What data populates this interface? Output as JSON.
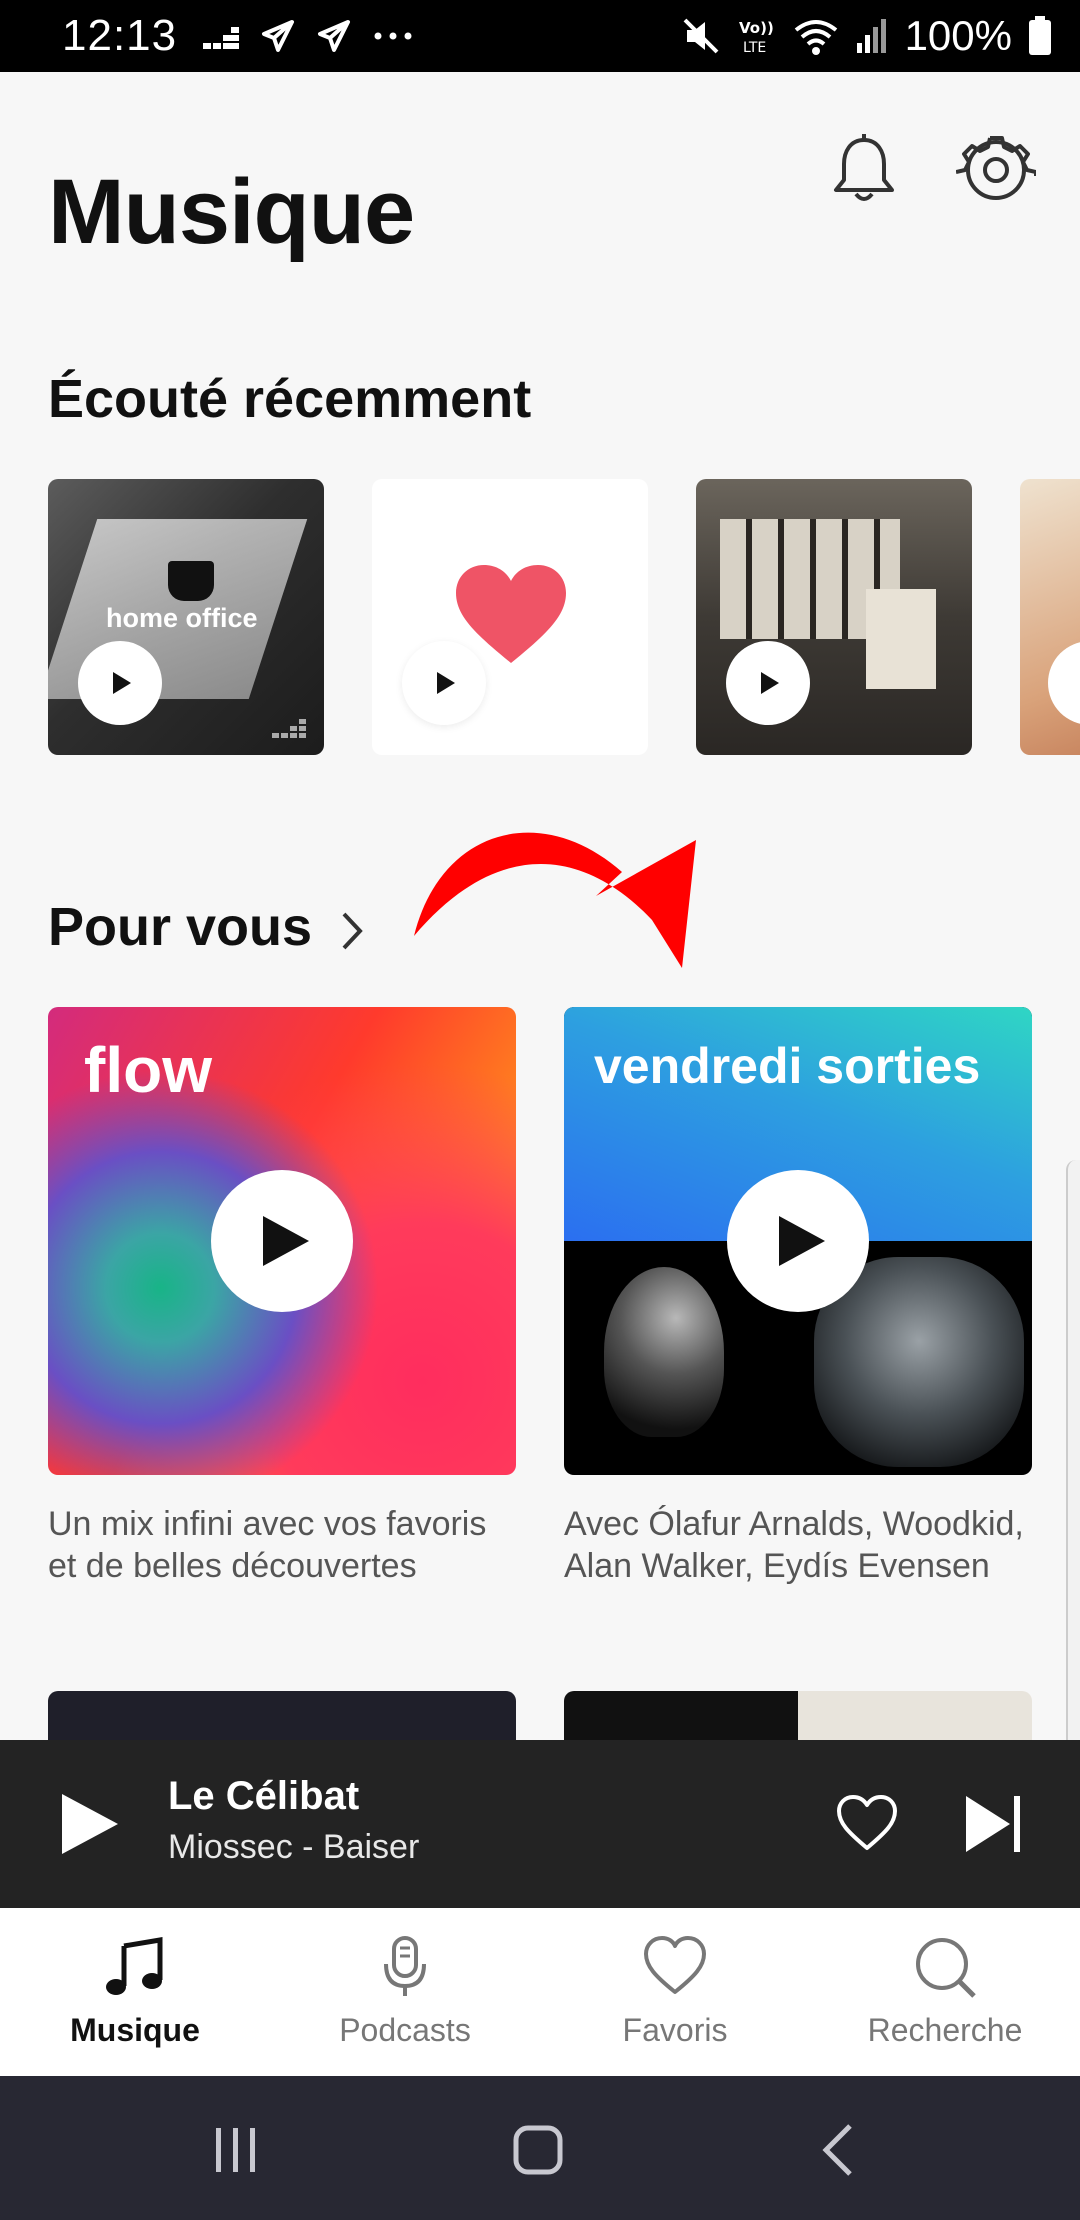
{
  "status_bar": {
    "time": "12:13",
    "battery": "100%"
  },
  "header": {
    "title": "Musique"
  },
  "recent": {
    "title": "Écouté récemment",
    "items": [
      {
        "label": "home office"
      },
      {
        "label": ""
      },
      {
        "label": ""
      },
      {
        "label": ""
      }
    ]
  },
  "for_you": {
    "title": "Pour vous",
    "cards": [
      {
        "label": "flow",
        "caption": "Un mix infini avec vos favoris et de belles découvertes"
      },
      {
        "label": "vendredi sorties",
        "caption": "Avec Ólafur Arnalds, Woodkid, Alan Walker, Eydís Evensen"
      }
    ]
  },
  "player": {
    "title": "Le Célibat",
    "subtitle": "Miossec - Baiser"
  },
  "nav": {
    "tabs": [
      {
        "label": "Musique",
        "icon": "music-note-icon",
        "active": true
      },
      {
        "label": "Podcasts",
        "icon": "microphone-icon",
        "active": false
      },
      {
        "label": "Favoris",
        "icon": "heart-icon",
        "active": false
      },
      {
        "label": "Recherche",
        "icon": "search-icon",
        "active": false
      }
    ]
  },
  "colors": {
    "annotation_arrow": "#ff0000",
    "player_bg": "#232323",
    "heart": "#ef5466"
  }
}
